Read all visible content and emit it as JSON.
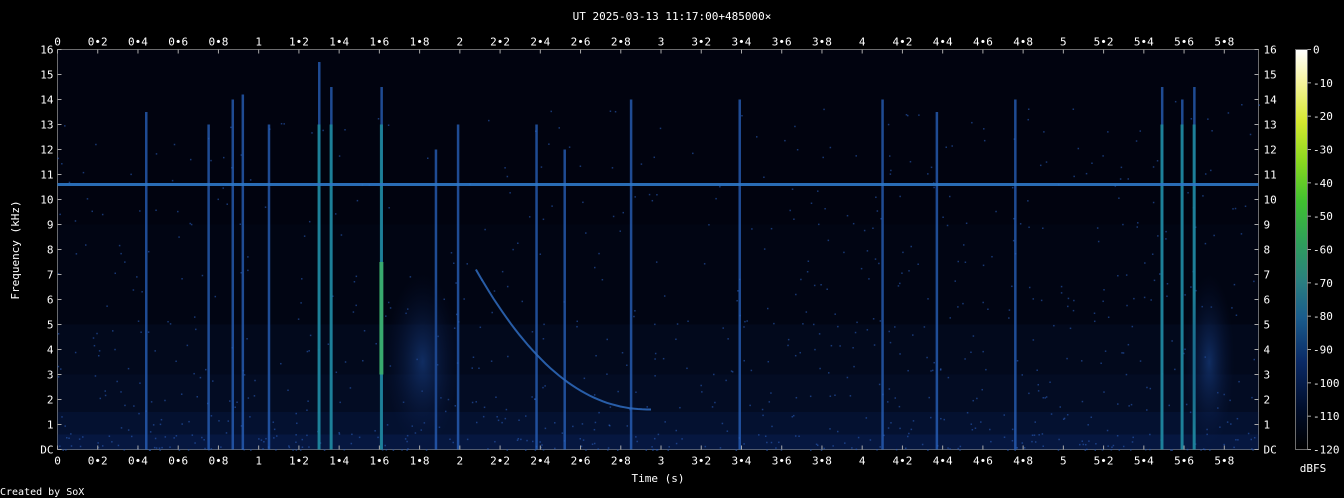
{
  "chart_data": {
    "type": "heatmap",
    "title": "UT 2025-03-13 11:17:00+485000×",
    "xlabel": "Time (s)",
    "ylabel": "Frequency (kHz)",
    "xlim": [
      0,
      5.97
    ],
    "ylim": [
      0,
      16
    ],
    "x_ticks": [
      "0",
      "0•2",
      "0•4",
      "0•6",
      "0•8",
      "1",
      "1•2",
      "1•4",
      "1•6",
      "1•8",
      "2",
      "2•2",
      "2•4",
      "2•6",
      "2•8",
      "3",
      "3•2",
      "3•4",
      "3•6",
      "3•8",
      "4",
      "4•2",
      "4•4",
      "4•6",
      "4•8",
      "5",
      "5•2",
      "5•4",
      "5•6",
      "5•8"
    ],
    "y_ticks": [
      "DC",
      "1",
      "2",
      "3",
      "4",
      "5",
      "6",
      "7",
      "8",
      "9",
      "10",
      "11",
      "12",
      "13",
      "14",
      "15",
      "16"
    ],
    "colorbar": {
      "label": "dBFS",
      "ticks": [
        "0",
        "-10",
        "-20",
        "-30",
        "-40",
        "-50",
        "-60",
        "-70",
        "-80",
        "-90",
        "-100",
        "-110",
        "-120"
      ],
      "range": [
        -120,
        0
      ]
    },
    "features": {
      "tone_khz": 10.6,
      "impulses": [
        {
          "t": 0.44,
          "fmax": 13.5
        },
        {
          "t": 0.75,
          "fmax": 13
        },
        {
          "t": 0.87,
          "fmax": 14
        },
        {
          "t": 0.92,
          "fmax": 14.2
        },
        {
          "t": 1.05,
          "fmax": 13
        },
        {
          "t": 1.3,
          "fmax": 15.5
        },
        {
          "t": 1.36,
          "fmax": 14.5
        },
        {
          "t": 1.61,
          "fmax": 14.5
        },
        {
          "t": 1.88,
          "fmax": 12
        },
        {
          "t": 1.99,
          "fmax": 13
        },
        {
          "t": 2.38,
          "fmax": 13
        },
        {
          "t": 2.52,
          "fmax": 12
        },
        {
          "t": 2.85,
          "fmax": 14
        },
        {
          "t": 3.39,
          "fmax": 14
        },
        {
          "t": 4.1,
          "fmax": 14
        },
        {
          "t": 4.37,
          "fmax": 13.5
        },
        {
          "t": 4.76,
          "fmax": 14
        },
        {
          "t": 5.49,
          "fmax": 14.5
        },
        {
          "t": 5.59,
          "fmax": 14
        },
        {
          "t": 5.65,
          "fmax": 14.5
        }
      ],
      "whistler": {
        "t_start": 2.08,
        "f_start": 7.2,
        "t_end": 2.95,
        "f_end": 1.6
      }
    }
  },
  "footer": {
    "created_by": "Created by SoX"
  }
}
